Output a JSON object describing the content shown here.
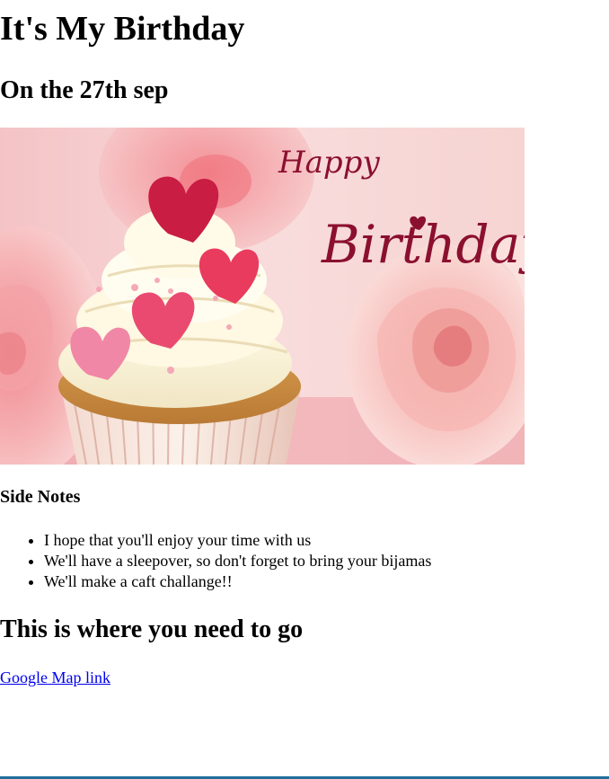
{
  "page": {
    "title": "It's My Birthday",
    "subtitle": "On the 27th sep"
  },
  "hero_image": {
    "script_line_1": "Happy",
    "script_line_2": "Birthday",
    "accent_color": "#8b1030"
  },
  "side_notes": {
    "heading": "Side Notes",
    "items": [
      "I hope that you'll enjoy your time with us",
      "We'll have a sleepover, so don't forget to bring your bijamas",
      "We'll make a caft challange!!"
    ]
  },
  "directions": {
    "heading": "This is where you need to go",
    "link_text": "Google Map link",
    "link_color": "#0000ee"
  }
}
